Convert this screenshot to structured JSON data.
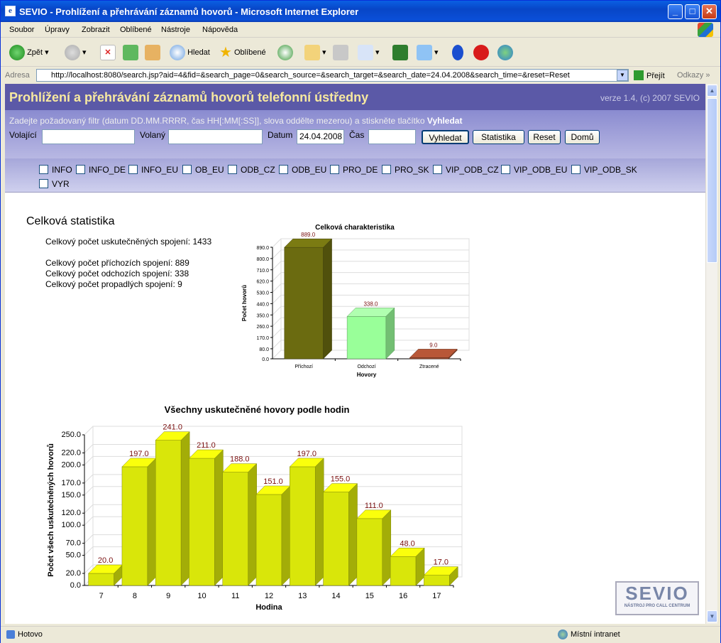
{
  "window": {
    "title": "SEVIO - Prohlížení a přehrávání záznamů hovorů - Microsoft Internet Explorer"
  },
  "menu": [
    "Soubor",
    "Úpravy",
    "Zobrazit",
    "Oblíbené",
    "Nástroje",
    "Nápověda"
  ],
  "toolbar": {
    "back": "Zpět",
    "search": "Hledat",
    "favorites": "Oblíbené"
  },
  "address": {
    "label": "Adresa",
    "url": "http://localhost:8080/search.jsp?aid=4&fid=&search_page=0&search_source=&search_target=&search_date=24.04.2008&search_time=&reset=Reset",
    "go": "Přejít",
    "links": "Odkazy"
  },
  "header": {
    "title": "Prohlížení a přehrávání záznamů hovorů telefonní ústředny",
    "version": "verze 1.4, (c) 2007 SEVIO"
  },
  "filter": {
    "hint": "Zadejte požadovaný filtr (datum DD.MM.RRRR, čas HH[:MM[:SS]], slova oddělte mezerou) a stiskněte tlačítko",
    "hint_bold": "Vyhledat",
    "caller_label": "Volající",
    "callee_label": "Volaný",
    "date_label": "Datum",
    "date_value": "24.04.2008",
    "time_label": "Čas",
    "btn_search": "Vyhledat",
    "btn_stats": "Statistika",
    "btn_reset": "Reset",
    "btn_home": "Domů"
  },
  "categories": [
    "INFO",
    "INFO_DE",
    "INFO_EU",
    "OB_EU",
    "ODB_CZ",
    "ODB_EU",
    "PRO_DE",
    "PRO_SK",
    "VIP_ODB_CZ",
    "VIP_ODB_EU",
    "VIP_ODB_SK",
    "VYR"
  ],
  "stats": {
    "title": "Celková statistika",
    "total": "Celkový počet uskutečněných spojení: 1433",
    "incoming": "Celkový počet příchozích spojení: 889",
    "outgoing": "Celkový počet odchozích spojení: 338",
    "missed": "Celkový počet propadlých spojení: 9"
  },
  "chart_data": [
    {
      "type": "bar",
      "title": "Celková charakteristika",
      "xlabel": "Hovory",
      "ylabel": "Počet hovorů",
      "categories": [
        "Příchozí",
        "Odchozí",
        "Ztracené"
      ],
      "values": [
        889.0,
        338.0,
        9.0
      ],
      "colors": [
        "#6b6b10",
        "#99ff99",
        "#a04c30"
      ],
      "ylim": [
        0,
        890
      ],
      "yticks": [
        0.0,
        80.0,
        170.0,
        260.0,
        350.0,
        440.0,
        530.0,
        620.0,
        710.0,
        800.0,
        890.0
      ],
      "value_labels": [
        "889.0",
        "338.0",
        "9.0"
      ]
    },
    {
      "type": "bar",
      "title": "Všechny uskutečněné hovory podle hodin",
      "xlabel": "Hodina",
      "ylabel": "Počet všech uskutečněných hovorů",
      "categories": [
        "7",
        "8",
        "9",
        "10",
        "11",
        "12",
        "13",
        "14",
        "15",
        "16",
        "17"
      ],
      "values": [
        20.0,
        197.0,
        241.0,
        211.0,
        188.0,
        151.0,
        197.0,
        155.0,
        111.0,
        48.0,
        17.0
      ],
      "colors": [
        "#d9e60a"
      ],
      "ylim": [
        0,
        250
      ],
      "yticks": [
        0.0,
        20.0,
        50.0,
        70.0,
        100.0,
        120.0,
        150.0,
        170.0,
        200.0,
        220.0,
        250.0
      ],
      "value_labels": [
        "20.0",
        "197.0",
        "241.0",
        "211.0",
        "188.0",
        "151.0",
        "197.0",
        "155.0",
        "111.0",
        "48.0",
        "17.0"
      ]
    }
  ],
  "logo": {
    "text": "SEVIO",
    "subtitle": "NÁSTROJ PRO CALL CENTRUM"
  },
  "status": {
    "left": "Hotovo",
    "right": "Místní intranet"
  }
}
